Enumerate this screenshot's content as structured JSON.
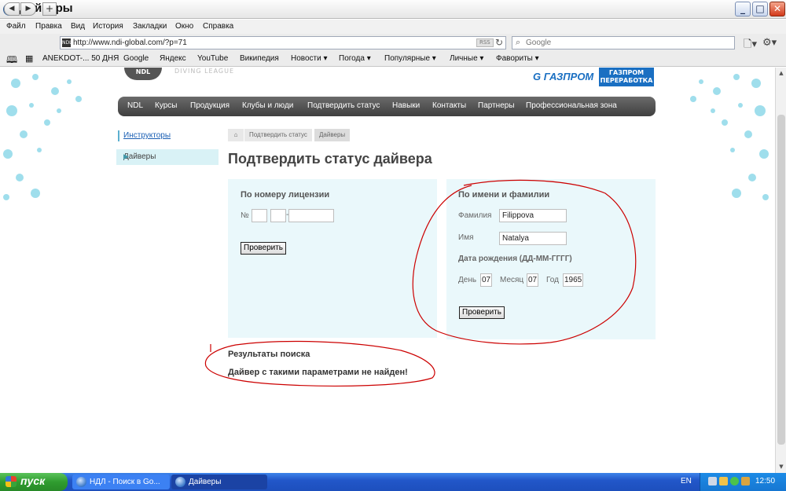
{
  "window": {
    "title": "Дайверы"
  },
  "menu": [
    "Файл",
    "Правка",
    "Вид",
    "История",
    "Закладки",
    "Окно",
    "Справка"
  ],
  "toolbar": {
    "url": "http://www.ndi-global.com/?p=71",
    "rss": "RSS",
    "search_placeholder": "Google"
  },
  "bookmarks": [
    "ANEKDOT-... 50 ДНЯ",
    "Google",
    "Яндекс",
    "YouTube",
    "Википедия",
    "Новости ▾",
    "Погода ▾",
    "Популярные ▾",
    "Личные ▾",
    "Фавориты ▾"
  ],
  "site": {
    "logo_gazprom": "ГАЗПРОМ",
    "logo_gazprom2": "ГАЗПРОМ ПЕРЕРАБОТКА",
    "nav": [
      "NDL",
      "Курсы",
      "Продукция",
      "Клубы и люди",
      "Подтвердить статус",
      "Навыки",
      "Контакты",
      "Партнеры",
      "Профессиональная зона"
    ],
    "sidebar": [
      "Инструкторы",
      "Дайверы"
    ],
    "breadcrumb": [
      "Подтвердить статус",
      "Дайверы"
    ],
    "page_title": "Подтвердить статус дайвера",
    "license_form": {
      "heading": "По номеру лицензии",
      "number_label": "№",
      "dash": "-",
      "submit": "Проверить"
    },
    "name_form": {
      "heading": "По имени и фамилии",
      "surname_label": "Фамилия",
      "surname_value": "Filippova",
      "name_label": "Имя",
      "name_value": "Natalya",
      "dob_label": "Дата рождения (ДД-ММ-ГГГГ)",
      "day_label": "День",
      "day_value": "07",
      "month_label": "Месяц",
      "month_value": "07",
      "year_label": "Год",
      "year_value": "1965",
      "submit": "Проверить"
    },
    "results": {
      "heading": "Результаты поиска",
      "message": "Дайвер с такими параметрами не найден!"
    }
  },
  "taskbar": {
    "start": "пуск",
    "items": [
      "НДЛ - Поиск в Go...",
      "Дайверы"
    ],
    "lang": "EN",
    "clock": "12:50"
  },
  "colors": {
    "annotation": "#cc0000",
    "panel_bg": "#eaf8fb",
    "nav_bg": "#4f4f4f",
    "link": "#1a5fb4"
  }
}
